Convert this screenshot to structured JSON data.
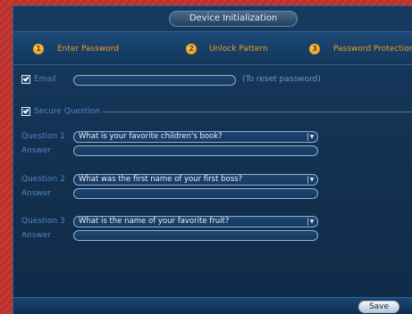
{
  "window": {
    "title": "Device Initialization"
  },
  "steps": [
    {
      "num": "1",
      "label": "Enter Password"
    },
    {
      "num": "2",
      "label": "Unlock Pattern"
    },
    {
      "num": "3",
      "label": "Password Protection"
    }
  ],
  "email": {
    "label": "Email",
    "checked": true,
    "value": "",
    "hint": "(To reset password)"
  },
  "secure": {
    "label": "Secure Question",
    "checked": true
  },
  "questions": [
    {
      "label": "Question 1",
      "value": "What is your favorite children's book?",
      "answer_label": "Answer",
      "answer": ""
    },
    {
      "label": "Question 2",
      "value": "What was the first name of your first boss?",
      "answer_label": "Answer",
      "answer": ""
    },
    {
      "label": "Question 3",
      "value": "What is the name of your favorite fruit?",
      "answer_label": "Answer",
      "answer": ""
    }
  ],
  "footer": {
    "save_label": "Save"
  },
  "colors": {
    "accent": "#f29a1e",
    "label_blue": "#4f86c0",
    "panel": "#163a5f",
    "background_red": "#b9312c"
  },
  "icons": {
    "checkbox": "check-icon",
    "dropdown": "chevron-down-icon"
  }
}
